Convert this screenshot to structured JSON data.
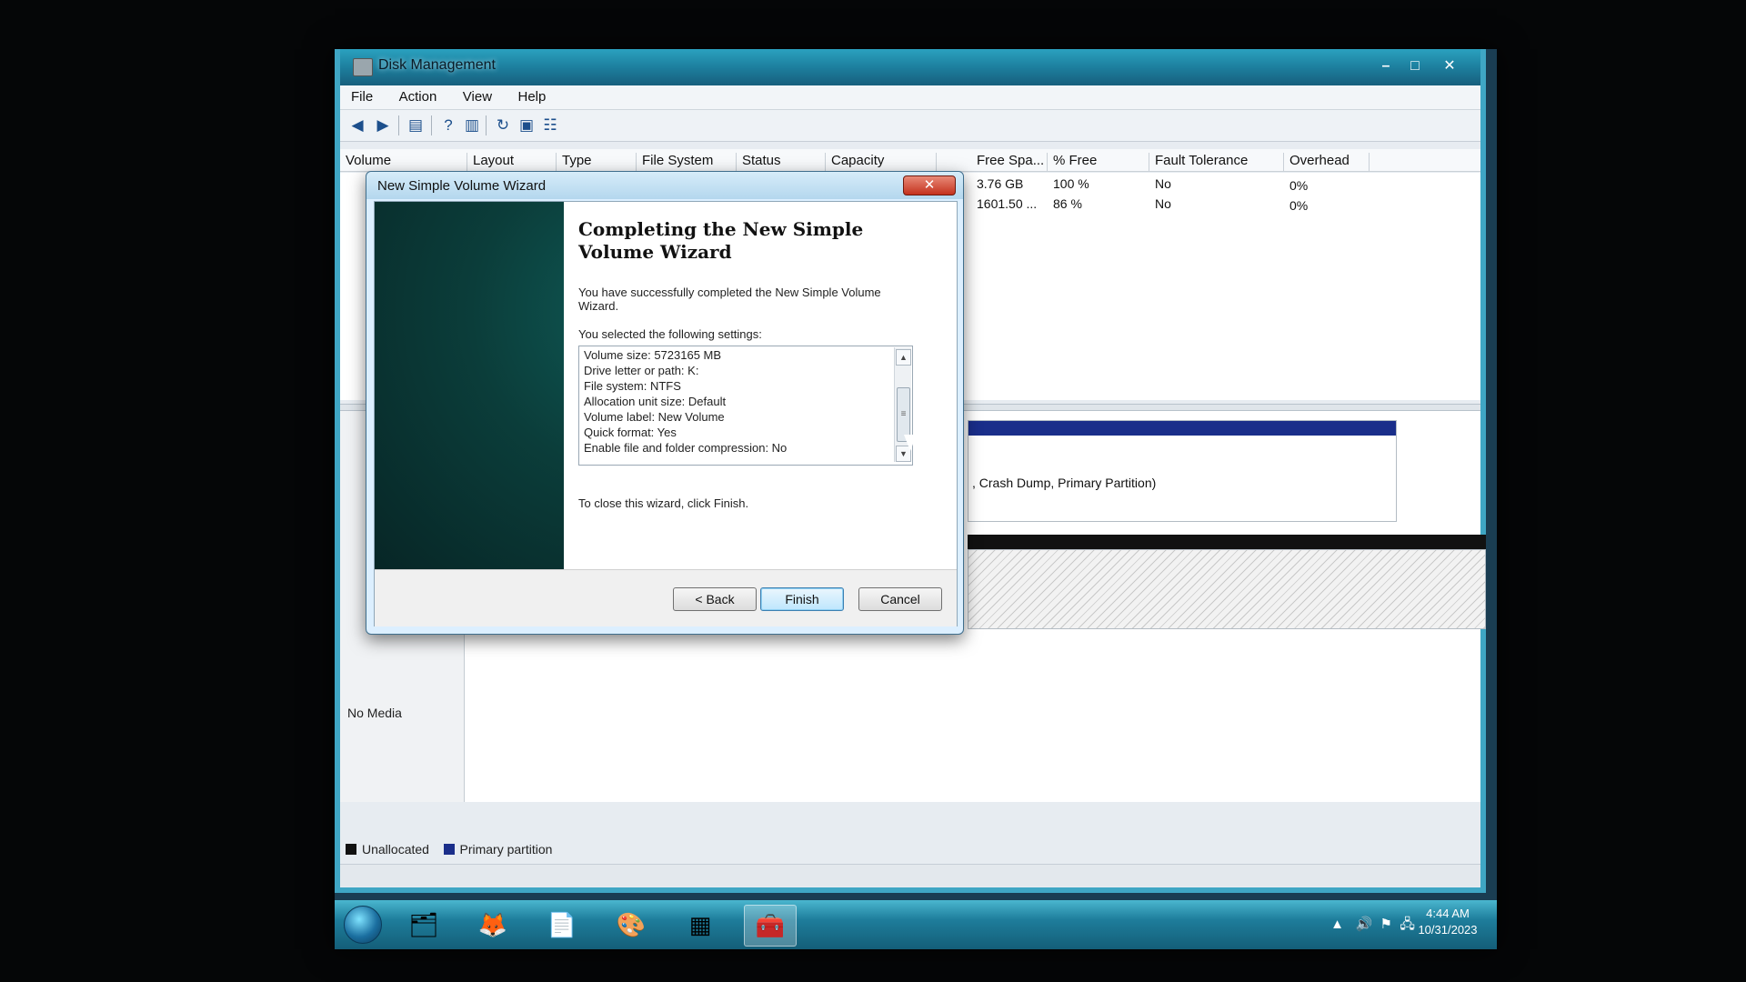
{
  "window": {
    "title": "Disk Management",
    "controls": {
      "minimize": "–",
      "maximize": "□",
      "close": "✕"
    }
  },
  "menu": [
    "File",
    "Action",
    "View",
    "Help"
  ],
  "volume_table": {
    "columns": [
      "Volume",
      "Layout",
      "Type",
      "File System",
      "Status",
      "Capacity",
      "Free Spa...",
      "% Free",
      "Fault Tolerance",
      "Overhead"
    ],
    "rows": [
      {
        "free": "3.76 GB",
        "pct_free": "100 %",
        "fault_tolerance": "No",
        "overhead": "0%"
      },
      {
        "free": "1601.50 ...",
        "pct_free": "86 %",
        "fault_tolerance": "No",
        "overhead": "0%"
      }
    ]
  },
  "graph": {
    "partition_text": ", Crash Dump, Primary Partition)",
    "no_media": "No Media"
  },
  "legend": {
    "items": [
      {
        "label": "Unallocated",
        "color": "#111111"
      },
      {
        "label": "Primary partition",
        "color": "#1a2e8a"
      }
    ]
  },
  "wizard": {
    "title": "New Simple Volume Wizard",
    "close": "✕",
    "heading": "Completing the New Simple Volume Wizard",
    "intro": "You have successfully completed the New Simple Volume Wizard.",
    "settings_label": "You selected the following settings:",
    "settings": [
      "Volume size: 5723165 MB",
      "Drive letter or path: K:",
      "File system: NTFS",
      "Allocation unit size: Default",
      "Volume label: New Volume",
      "Quick format: Yes",
      "Enable file and folder compression: No"
    ],
    "close_instruction": "To close this wizard, click Finish.",
    "buttons": {
      "back": "< Back",
      "finish": "Finish",
      "cancel": "Cancel"
    }
  },
  "taskbar": {
    "time": "4:44 AM",
    "date": "10/31/2023"
  }
}
